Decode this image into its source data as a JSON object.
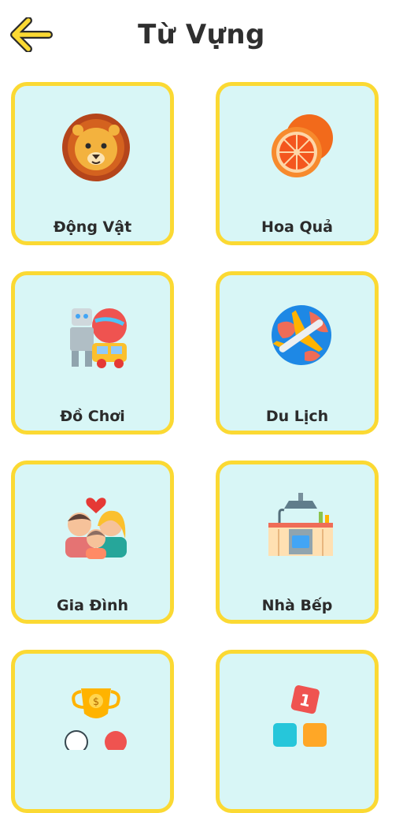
{
  "header": {
    "title": "Từ Vựng"
  },
  "categories": [
    {
      "label": "Động Vật",
      "icon": "lion-icon"
    },
    {
      "label": "Hoa Quả",
      "icon": "orange-icon"
    },
    {
      "label": "Đồ Chơi",
      "icon": "toys-icon"
    },
    {
      "label": "Du Lịch",
      "icon": "globe-plane-icon"
    },
    {
      "label": "Gia Đình",
      "icon": "family-icon"
    },
    {
      "label": "Nhà Bếp",
      "icon": "kitchen-icon"
    },
    {
      "label": "",
      "icon": "sports-trophy-icon"
    },
    {
      "label": "",
      "icon": "numbers-icon"
    }
  ],
  "colors": {
    "card_border": "#fbd933",
    "card_bg": "#d8f6f6",
    "back_arrow": "#fbd933"
  }
}
